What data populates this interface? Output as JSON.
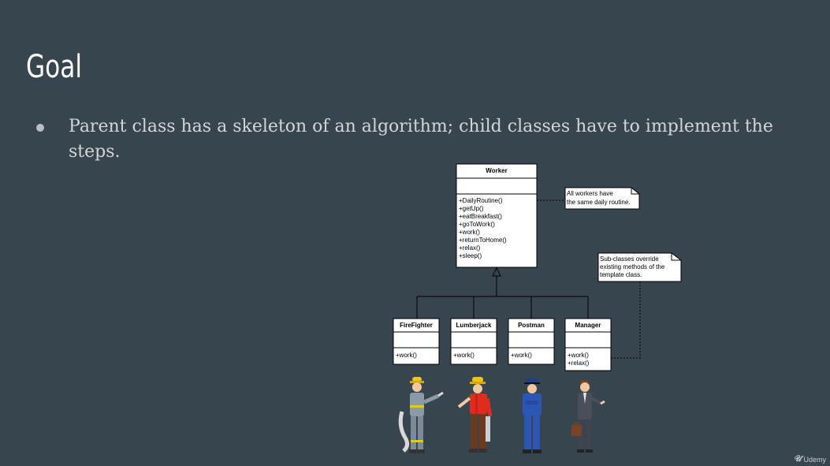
{
  "slide": {
    "title": "Goal",
    "bullet": "Parent class has a skeleton of an algorithm; child classes have to implement the steps."
  },
  "diagram": {
    "parent": {
      "name": "Worker",
      "methods": [
        "+DailyRoutine()",
        "+getUp()",
        "+eatBreakfast()",
        "+goToWork()",
        "+work()",
        "+returnToHome()",
        "+relax()",
        "+sleep()"
      ]
    },
    "children": [
      {
        "name": "FireFighter",
        "methods": [
          "+work()"
        ]
      },
      {
        "name": "Lumberjack",
        "methods": [
          "+work()"
        ]
      },
      {
        "name": "Postman",
        "methods": [
          "+work()"
        ]
      },
      {
        "name": "Manager",
        "methods": [
          "+work()",
          "+relax()"
        ]
      }
    ],
    "note_parent": [
      "All workers have",
      "the same daily routine."
    ],
    "note_children": [
      "Sub-classes override",
      "existing methods of the",
      "template class."
    ]
  },
  "figures": [
    "firefighter",
    "lumberjack",
    "postman",
    "manager"
  ],
  "branding": {
    "logo": "Udemy"
  }
}
